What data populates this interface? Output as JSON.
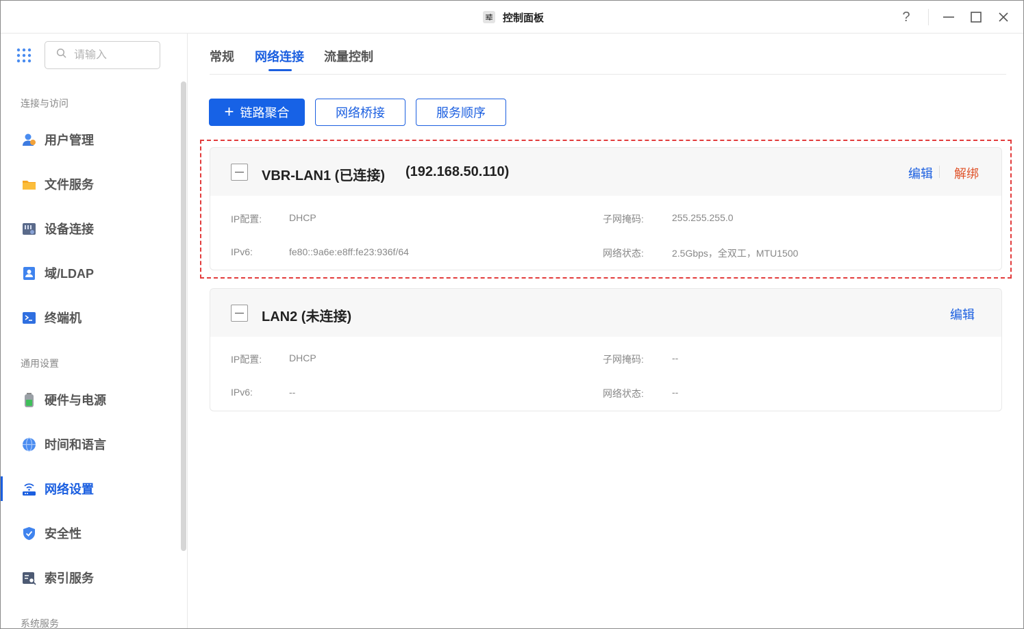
{
  "window": {
    "title": "控制面板",
    "icons": {
      "title": "sliders-icon",
      "help": "help-icon",
      "minimize": "minimize-icon",
      "maximize": "maximize-icon",
      "close": "close-icon"
    },
    "help_label": "?"
  },
  "sidebar": {
    "search_placeholder": "请输入",
    "sections": [
      {
        "title": "连接与访问",
        "items": [
          {
            "label": "用户管理",
            "icon": "users-icon"
          },
          {
            "label": "文件服务",
            "icon": "folder-icon"
          },
          {
            "label": "设备连接",
            "icon": "device-icon"
          },
          {
            "label": "域/LDAP",
            "icon": "id-card-icon"
          },
          {
            "label": "终端机",
            "icon": "terminal-icon"
          }
        ]
      },
      {
        "title": "通用设置",
        "items": [
          {
            "label": "硬件与电源",
            "icon": "battery-icon"
          },
          {
            "label": "时间和语言",
            "icon": "globe-icon"
          },
          {
            "label": "网络设置",
            "icon": "router-icon",
            "active": true
          },
          {
            "label": "安全性",
            "icon": "shield-icon"
          },
          {
            "label": "索引服务",
            "icon": "index-icon"
          }
        ]
      },
      {
        "title": "系统服务",
        "items": []
      }
    ]
  },
  "tabs": [
    {
      "label": "常规"
    },
    {
      "label": "网络连接",
      "active": true
    },
    {
      "label": "流量控制"
    }
  ],
  "toolbar": {
    "link_aggregation": "链路聚合",
    "bridge": "网络桥接",
    "service_order": "服务顺序"
  },
  "interfaces": [
    {
      "name": "VBR-LAN1 (已连接)",
      "ip": "(192.168.50.110)",
      "edit": "编辑",
      "unbind": "解绑",
      "ip_config_label": "IP配置:",
      "ip_config": "DHCP",
      "subnet_label": "子网掩码:",
      "subnet": "255.255.255.0",
      "ipv6_label": "IPv6:",
      "ipv6": "fe80::9a6e:e8ff:fe23:936f/64",
      "status_label": "网络状态:",
      "status": "2.5Gbps，全双工，MTU1500"
    },
    {
      "name": "LAN2 (未连接)",
      "edit": "编辑",
      "ip_config_label": "IP配置:",
      "ip_config": "DHCP",
      "subnet_label": "子网掩码:",
      "subnet": "--",
      "ipv6_label": "IPv6:",
      "ipv6": "--",
      "status_label": "网络状态:",
      "status": "--"
    }
  ],
  "colors": {
    "accent": "#1b5fe0",
    "danger": "#e0542b",
    "highlight_border": "#e23b3b"
  }
}
